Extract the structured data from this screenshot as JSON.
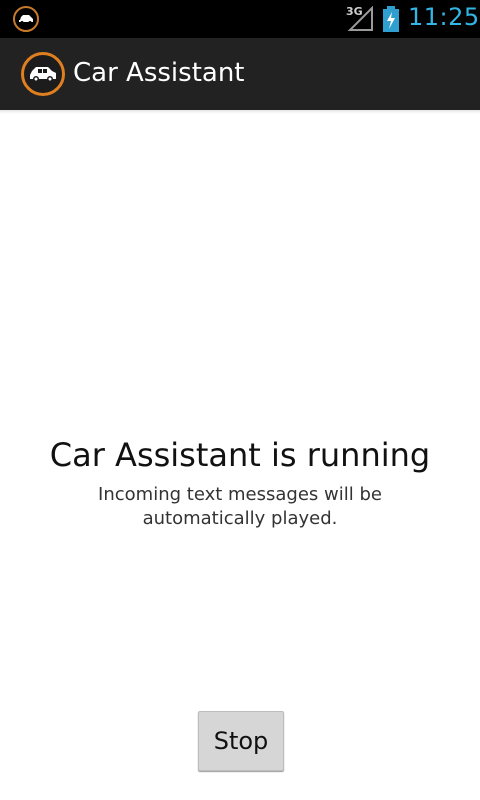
{
  "status_bar": {
    "notification_icon": "car-icon",
    "network_type": "3G",
    "signal_icon": "signal-icon",
    "battery_icon": "battery-charging-icon",
    "time": "11:25",
    "time_color": "#33b5e5"
  },
  "action_bar": {
    "app_icon": "car-icon",
    "title": "Car Assistant",
    "icon_accent": "#e07f20"
  },
  "main": {
    "headline": "Car Assistant is running",
    "message": "Incoming text messages will be automatically played.",
    "stop_label": "Stop"
  }
}
